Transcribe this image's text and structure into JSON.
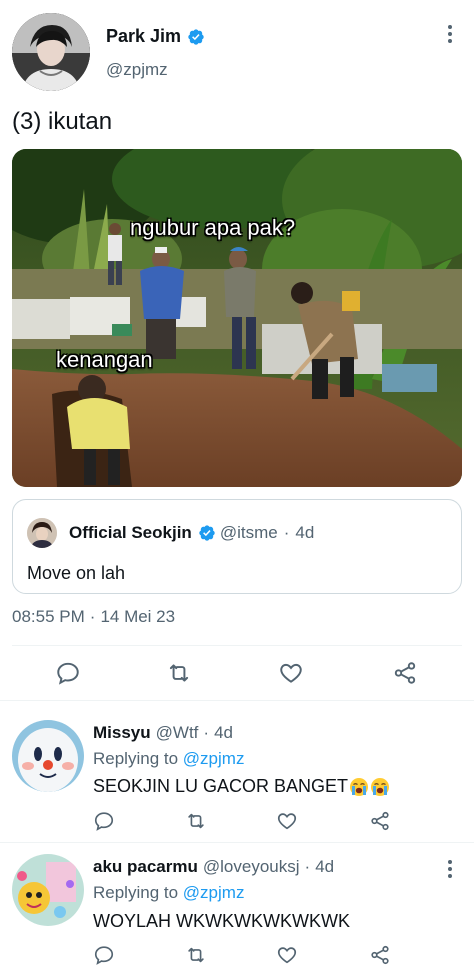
{
  "tweet": {
    "author_name": "Park Jim",
    "author_handle": "@zpjmz",
    "text": "(3) ikutan",
    "meme": {
      "caption_top": "ngubur apa pak?",
      "caption_left": "kenangan"
    },
    "quote": {
      "name": "Official Seokjin",
      "handle": "@itsme",
      "separator": "·",
      "time": "4d",
      "text": "Move on lah"
    },
    "timestamp": {
      "time": "08:55 PM",
      "separator": "·",
      "date": "14 Mei 23"
    },
    "actions": [
      "reply-icon",
      "retweet-icon",
      "like-icon",
      "share-icon"
    ]
  },
  "replies": [
    {
      "name": "Missyu",
      "handle": "@Wtf",
      "separator": "·",
      "time": "4d",
      "replying_prefix": "Replying to",
      "replying_to": "@zpjmz",
      "text": "SEOKJIN LU GACOR BANGET",
      "emojis": [
        "loudly-crying-face",
        "loudly-crying-face"
      ]
    },
    {
      "name": "aku pacarmu",
      "handle": "@loveyouksj",
      "separator": "·",
      "time": "4d",
      "replying_prefix": "Replying to",
      "replying_to": "@zpjmz",
      "text": "WOYLAH WKWKWKWKWKWK"
    }
  ],
  "colors": {
    "text_primary": "#0f1419",
    "text_secondary": "#536471",
    "link": "#1d9bf0",
    "verified": "#1d9bf0",
    "divider": "#eff3f4"
  }
}
